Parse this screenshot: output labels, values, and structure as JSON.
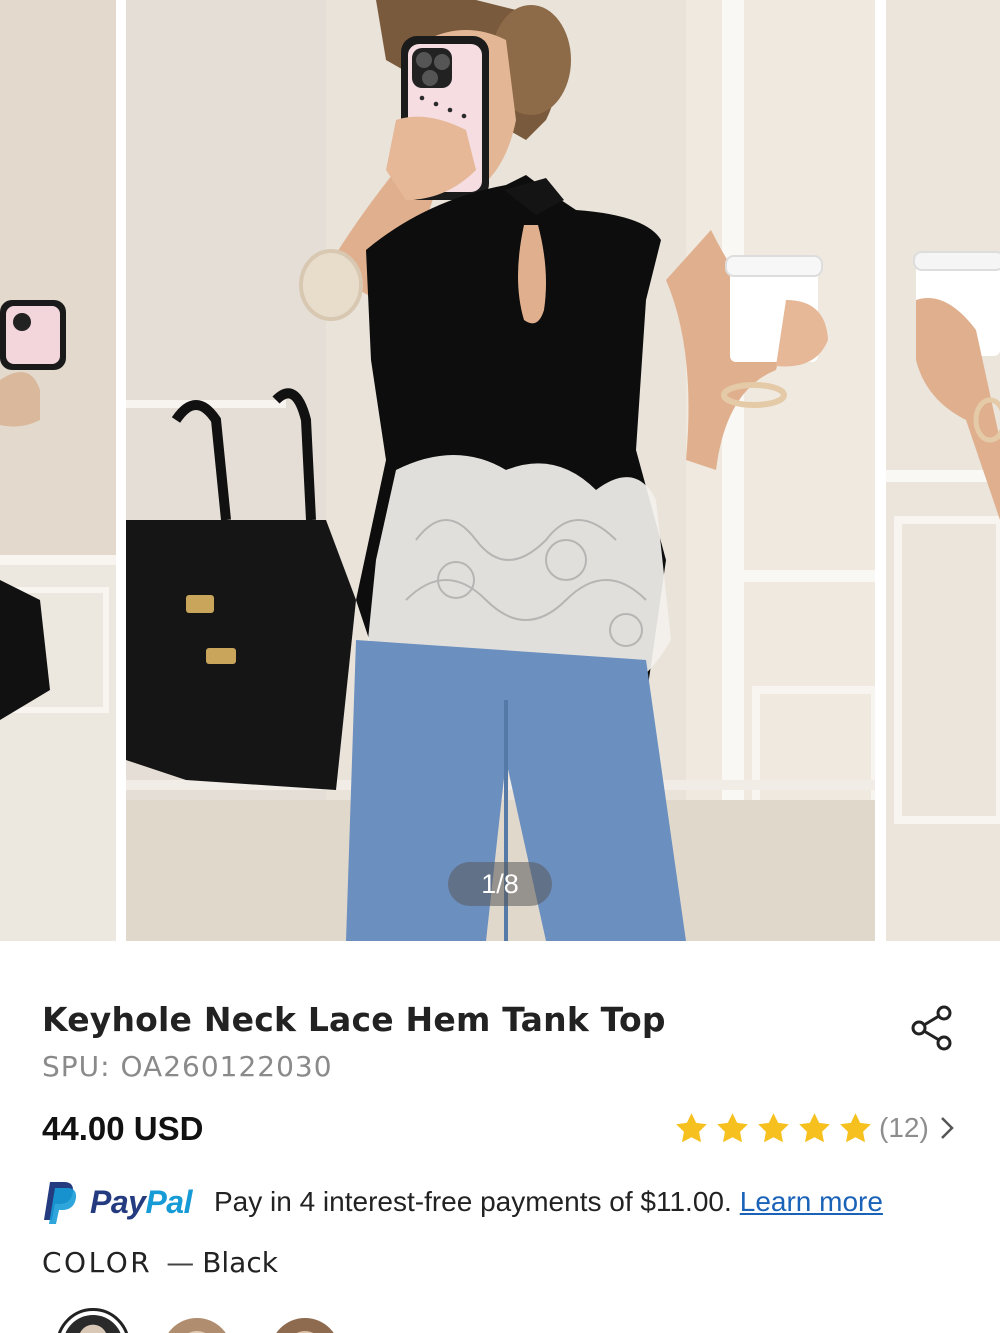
{
  "gallery": {
    "counter": "1/8",
    "current_image": 1,
    "total_images": 8
  },
  "product": {
    "title": "Keyhole Neck Lace Hem Tank Top",
    "spu": "SPU: OA260122030",
    "price": "44.00 USD",
    "rating": {
      "stars": 5,
      "review_count": "(12)"
    }
  },
  "paypal": {
    "brand_pay": "Pay",
    "brand_pal": "Pal",
    "message": "Pay in 4 interest-free payments of $11.00.",
    "link": "Learn more"
  },
  "color": {
    "label": "COLOR",
    "separator": "—",
    "selected": "Black"
  },
  "colors": {
    "star": "#f6c01e",
    "paypal_dark": "#253b80",
    "paypal_light": "#179bd7",
    "link": "#1a62b8"
  }
}
